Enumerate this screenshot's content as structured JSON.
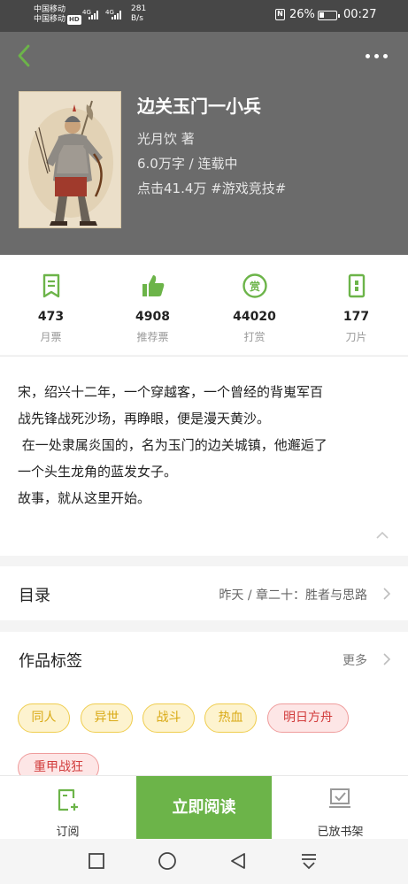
{
  "status_bar": {
    "carrier1": "中国移动",
    "carrier2": "中国移动",
    "hd": "HD",
    "net1": "4G",
    "net2": "4G",
    "speed_value": "281",
    "speed_unit": "B/s",
    "nfc": "N",
    "battery_pct": "26%",
    "battery_level": 0.26,
    "time": "00:27"
  },
  "header": {
    "back_icon": "chevron-left-icon",
    "more_icon": "more-dots-icon",
    "accent": "#6cb449"
  },
  "book": {
    "title": "边关玉门一小兵",
    "author": "光月饮  著",
    "word_count": "6.0万字 / 连载中",
    "clicks": "点击41.4万  #游戏竞技#"
  },
  "stats": [
    {
      "icon": "monthly-ticket-icon",
      "value": "473",
      "label": "月票"
    },
    {
      "icon": "thumbs-up-icon",
      "value": "4908",
      "label": "推荐票"
    },
    {
      "icon": "reward-coin-icon",
      "value": "44020",
      "label": "打赏"
    },
    {
      "icon": "blade-icon",
      "value": "177",
      "label": "刀片"
    }
  ],
  "synopsis": {
    "lines": [
      "宋，绍兴十二年，一个穿越客，一个曾经的背嵬军百",
      "战先锋战死沙场，再睁眼，便是漫天黄沙。",
      " 在一处隶属炎国的，名为玉门的边关城镇，他邂逅了",
      "一个头生龙角的蓝发女子。",
      "故事，就从这里开始。"
    ]
  },
  "toc": {
    "title": "目录",
    "latest": "昨天 / 章二十：胜者与思路"
  },
  "tags": {
    "title": "作品标签",
    "more": "更多",
    "items": [
      {
        "label": "同人",
        "style": "yellow"
      },
      {
        "label": "异世",
        "style": "yellow"
      },
      {
        "label": "战斗",
        "style": "yellow"
      },
      {
        "label": "热血",
        "style": "yellow"
      },
      {
        "label": "明日方舟",
        "style": "red"
      },
      {
        "label": "重甲战狂",
        "style": "red"
      }
    ]
  },
  "bottom_bar": {
    "subscribe_label": "订阅",
    "read_label": "立即阅读",
    "shelf_label": "已放书架"
  },
  "system_nav": {
    "recent": "square-icon",
    "home": "circle-icon",
    "back": "triangle-back-icon",
    "menu": "pull-down-icon"
  }
}
